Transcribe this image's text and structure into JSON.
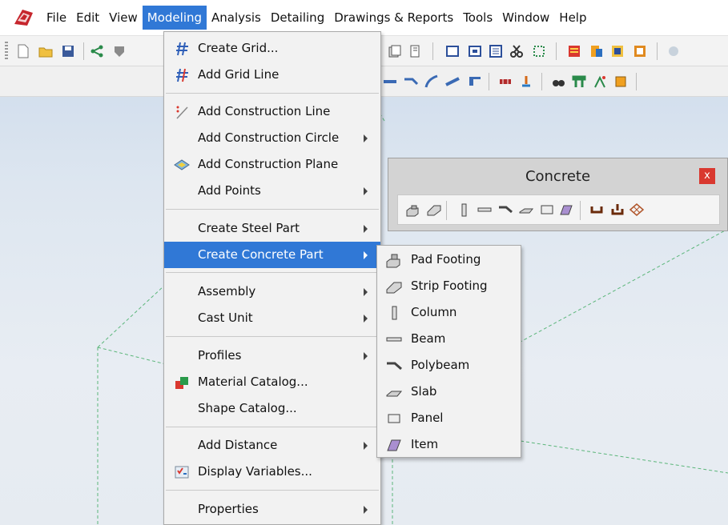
{
  "menubar": {
    "items": [
      "File",
      "Edit",
      "View",
      "Modeling",
      "Analysis",
      "Detailing",
      "Drawings & Reports",
      "Tools",
      "Window",
      "Help"
    ],
    "active": "Modeling"
  },
  "modeling_menu": {
    "items": [
      {
        "label": "Create Grid...",
        "icon": "grid-icon",
        "submenu": false
      },
      {
        "label": "Add Grid Line",
        "icon": "grid-line-icon",
        "submenu": false
      },
      {
        "label": "Add Construction Line",
        "icon": "construction-line-icon",
        "submenu": false
      },
      {
        "label": "Add Construction Circle",
        "icon": "",
        "submenu": true
      },
      {
        "label": "Add Construction Plane",
        "icon": "construction-plane-icon",
        "submenu": false
      },
      {
        "label": "Add Points",
        "icon": "",
        "submenu": true
      },
      {
        "label": "Create Steel Part",
        "icon": "",
        "submenu": true
      },
      {
        "label": "Create Concrete Part",
        "icon": "",
        "submenu": true,
        "highlighted": true
      },
      {
        "label": "Assembly",
        "icon": "",
        "submenu": true
      },
      {
        "label": "Cast Unit",
        "icon": "",
        "submenu": true
      },
      {
        "label": "Profiles",
        "icon": "",
        "submenu": true
      },
      {
        "label": "Material Catalog...",
        "icon": "material-catalog-icon",
        "submenu": false
      },
      {
        "label": "Shape Catalog...",
        "icon": "",
        "submenu": false
      },
      {
        "label": "Add Distance",
        "icon": "",
        "submenu": true
      },
      {
        "label": "Display Variables...",
        "icon": "display-variables-icon",
        "submenu": false
      },
      {
        "label": "Properties",
        "icon": "",
        "submenu": true
      }
    ]
  },
  "concrete_submenu": {
    "items": [
      {
        "label": "Pad Footing",
        "icon": "pad-footing-icon"
      },
      {
        "label": "Strip Footing",
        "icon": "strip-footing-icon"
      },
      {
        "label": "Column",
        "icon": "column-icon"
      },
      {
        "label": "Beam",
        "icon": "beam-icon"
      },
      {
        "label": "Polybeam",
        "icon": "polybeam-icon"
      },
      {
        "label": "Slab",
        "icon": "slab-icon"
      },
      {
        "label": "Panel",
        "icon": "panel-icon"
      },
      {
        "label": "Item",
        "icon": "item-icon"
      }
    ]
  },
  "concrete_toolbar": {
    "title": "Concrete",
    "close_label": "x"
  },
  "colors": {
    "highlight": "#3078d6",
    "menu_bg": "#f2f2f2",
    "close_button": "#d9382f"
  }
}
